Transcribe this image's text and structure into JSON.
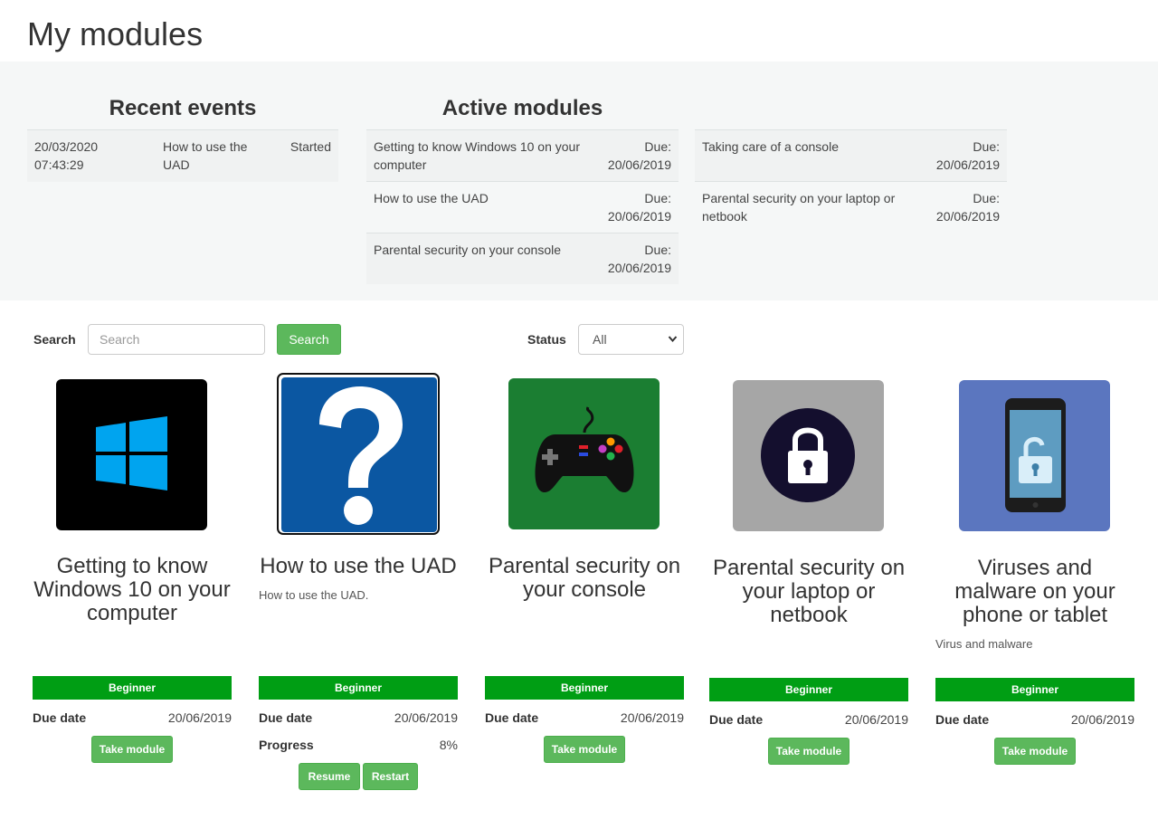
{
  "page": {
    "title": "My modules"
  },
  "recent_events": {
    "heading": "Recent events",
    "items": [
      {
        "date": "20/03/2020",
        "time": "07:43:29",
        "module_line1": "How to use the",
        "module_line2": "UAD",
        "status": "Started"
      }
    ]
  },
  "active_modules": {
    "heading": "Active modules",
    "due_label": "Due:",
    "left": [
      {
        "name_line1": "Getting to know Windows 10 on your",
        "name_line2": "computer",
        "due": "20/06/2019"
      },
      {
        "name_line1": "How to use the UAD",
        "name_line2": "",
        "due": "20/06/2019"
      },
      {
        "name_line1": "Parental security on your console",
        "name_line2": "",
        "due": "20/06/2019"
      }
    ],
    "right": [
      {
        "name_line1": "Taking care of a console",
        "name_line2": "",
        "due": "20/06/2019"
      },
      {
        "name_line1": "Parental security on your laptop or",
        "name_line2": "netbook",
        "due": "20/06/2019"
      }
    ]
  },
  "filters": {
    "search_label": "Search",
    "search_placeholder": "Search",
    "search_value": "",
    "search_button": "Search",
    "status_label": "Status",
    "status_selected": "All"
  },
  "cards": [
    {
      "title_lines": [
        "Getting to know",
        "Windows 10 on your",
        "computer"
      ],
      "description": "",
      "level": "Beginner",
      "due_label": "Due date",
      "due": "20/06/2019",
      "button": "Take module",
      "icon": "windows-logo-icon"
    },
    {
      "title_lines": [
        "How to use the UAD"
      ],
      "description": "How to use the UAD.",
      "level": "Beginner",
      "due_label": "Due date",
      "due": "20/06/2019",
      "progress_label": "Progress",
      "progress": "8%",
      "resume_button": "Resume",
      "restart_button": "Restart",
      "icon": "question-mark-icon"
    },
    {
      "title_lines": [
        "Parental security on",
        "your console"
      ],
      "description": "",
      "level": "Beginner",
      "due_label": "Due date",
      "due": "20/06/2019",
      "button": "Take module",
      "icon": "game-controller-icon"
    },
    {
      "title_lines": [
        "Parental security on",
        "your laptop or",
        "netbook"
      ],
      "description": "",
      "level": "Beginner",
      "due_label": "Due date",
      "due": "20/06/2019",
      "button": "Take module",
      "icon": "padlock-icon"
    },
    {
      "title_lines": [
        "Viruses and",
        "malware on your",
        "phone or tablet"
      ],
      "description": "Virus and malware",
      "level": "Beginner",
      "due_label": "Due date",
      "due": "20/06/2019",
      "button": "Take module",
      "icon": "phone-unlock-icon"
    }
  ],
  "colors": {
    "accent_green": "#5cb85c",
    "level_green": "#009e14",
    "summary_bg": "#f5f7f7"
  }
}
